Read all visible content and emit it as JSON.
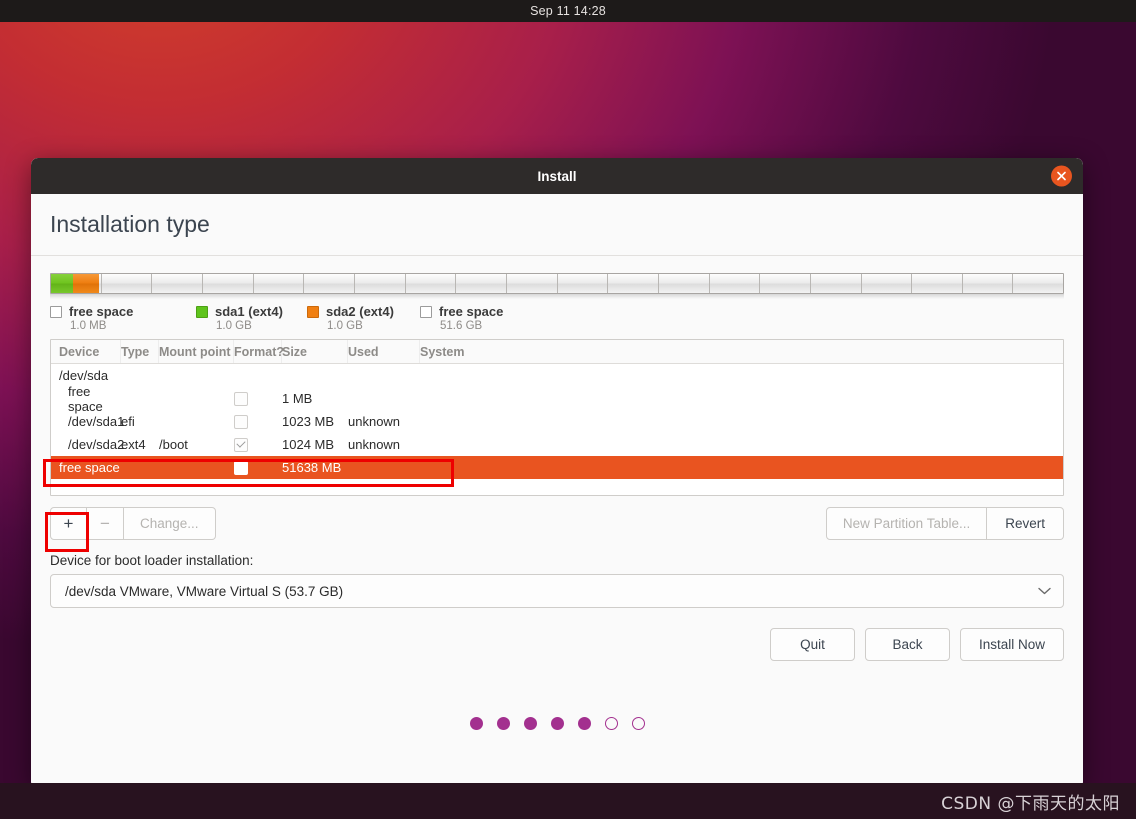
{
  "desktop": {
    "clock": "Sep 11  14:28",
    "watermark": "CSDN @下雨天的太阳"
  },
  "window": {
    "title": "Install",
    "close_icon": "close-icon",
    "page_title": "Installation type"
  },
  "disk_bar": {
    "segments": [
      {
        "name": "sda1",
        "color": "#5fc41c",
        "pct": 2.2
      },
      {
        "name": "sda2",
        "color": "#f07f12",
        "pct": 2.5
      },
      {
        "name": "free",
        "color": "#e9e9e9",
        "pct": 95.3
      }
    ]
  },
  "legend": [
    {
      "label": "free space",
      "size": "1.0 MB",
      "swatch": "empty"
    },
    {
      "label": "sda1 (ext4)",
      "size": "1.0 GB",
      "swatch": "green"
    },
    {
      "label": "sda2 (ext4)",
      "size": "1.0 GB",
      "swatch": "orange"
    },
    {
      "label": "free space",
      "size": "51.6 GB",
      "swatch": "empty"
    }
  ],
  "table": {
    "columns": [
      "Device",
      "Type",
      "Mount point",
      "Format?",
      "Size",
      "Used",
      "System"
    ],
    "rows": [
      {
        "device": "/dev/sda",
        "type": "",
        "mount": "",
        "format": "none",
        "size": "",
        "used": "",
        "system": "",
        "indent": false,
        "selected": false
      },
      {
        "device": "free space",
        "type": "",
        "mount": "",
        "format": "unchecked",
        "size": "1 MB",
        "used": "",
        "system": "",
        "indent": true,
        "selected": false
      },
      {
        "device": "/dev/sda1",
        "type": "efi",
        "mount": "",
        "format": "unchecked",
        "size": "1023 MB",
        "used": "unknown",
        "system": "",
        "indent": true,
        "selected": false
      },
      {
        "device": "/dev/sda2",
        "type": "ext4",
        "mount": "/boot",
        "format": "checked",
        "size": "1024 MB",
        "used": "unknown",
        "system": "",
        "indent": true,
        "selected": false
      },
      {
        "device": "free space",
        "type": "",
        "mount": "",
        "format": "unchecked",
        "size": "51638 MB",
        "used": "",
        "system": "",
        "indent": false,
        "selected": true
      }
    ]
  },
  "toolbar": {
    "add_label": "+",
    "remove_label": "−",
    "change_label": "Change...",
    "new_partition_table_label": "New Partition Table...",
    "revert_label": "Revert"
  },
  "bootloader": {
    "label": "Device for boot loader installation:",
    "selected": "/dev/sda   VMware, VMware Virtual S (53.7 GB)",
    "chevron": "chevron-down-icon"
  },
  "footer": {
    "quit_label": "Quit",
    "back_label": "Back",
    "install_label": "Install Now"
  },
  "progress_dots": {
    "total": 7,
    "filled": 5
  },
  "colors": {
    "accent_orange": "#e95420",
    "titlebar": "#2e2b2a",
    "dot_purple": "#a3308f",
    "annotation_red": "#ee0000"
  }
}
